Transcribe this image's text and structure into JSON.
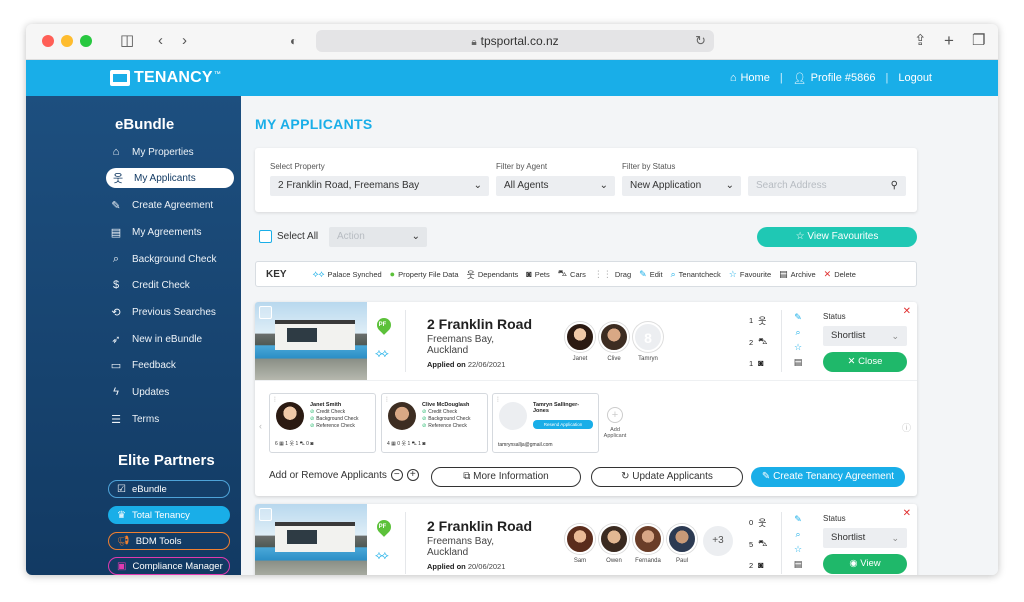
{
  "browser": {
    "url": "tpsportal.co.nz"
  },
  "header": {
    "logo": "TENANCY",
    "logo_tm": "™",
    "home": "Home",
    "profile": "Profile #5866",
    "logout": "Logout"
  },
  "sidebar": {
    "title": "eBundle",
    "items": [
      {
        "label": "My Properties",
        "icon": "home-icon"
      },
      {
        "label": "My Applicants",
        "icon": "users-icon"
      },
      {
        "label": "Create Agreement",
        "icon": "edit-icon"
      },
      {
        "label": "My Agreements",
        "icon": "document-icon"
      },
      {
        "label": "Background Check",
        "icon": "search-doc-icon"
      },
      {
        "label": "Credit Check",
        "icon": "dollar-doc-icon"
      },
      {
        "label": "Previous Searches",
        "icon": "history-icon"
      },
      {
        "label": "New in eBundle",
        "icon": "rocket-icon"
      },
      {
        "label": "Feedback",
        "icon": "chat-icon"
      },
      {
        "label": "Updates",
        "icon": "bolt-icon"
      },
      {
        "label": "Terms",
        "icon": "list-icon"
      }
    ],
    "partners_title": "Elite Partners",
    "partners": [
      {
        "label": "eBundle"
      },
      {
        "label": "Total Tenancy"
      },
      {
        "label": "BDM Tools"
      },
      {
        "label": "Compliance Manager"
      }
    ]
  },
  "main": {
    "title": "MY APPLICANTS",
    "filters": {
      "property_label": "Select Property",
      "property_value": "2 Franklin Road, Freemans Bay",
      "agent_label": "Filter by Agent",
      "agent_value": "All Agents",
      "status_label": "Filter by Status",
      "status_value": "New Application",
      "search_placeholder": "Search Address"
    },
    "select_all": "Select All",
    "action_placeholder": "Action",
    "view_favourites": "View Favourites",
    "key": {
      "title": "KEY",
      "items": [
        "Palace Synched",
        "Property File Data",
        "Dependants",
        "Pets",
        "Cars",
        "Drag",
        "Edit",
        "Tenantcheck",
        "Favourite",
        "Archive",
        "Delete"
      ]
    }
  },
  "cards": [
    {
      "address": "2 Franklin Road",
      "suburb": "Freemans Bay,",
      "city": "Auckland",
      "applied_label": "Applied on",
      "applied_date": "22/06/2021",
      "applicants": [
        "Janet",
        "Clive",
        "Tamryn"
      ],
      "dependants": "1",
      "cars": "2",
      "pets": "1",
      "status_label": "Status",
      "status_value": "Shortlist",
      "action_button": "Close",
      "expanded": {
        "applicants": [
          {
            "name": "Janet Smith",
            "checks": [
              "Credit Check",
              "Background Check",
              "Reference Check"
            ],
            "footer": "6 ▦   1 웃   1 ⛍   0 ◙"
          },
          {
            "name": "Clive McDouglash",
            "checks": [
              "Credit Check",
              "Background Check",
              "Reference Check"
            ],
            "footer": "4 ▦   0 웃   1 ⛍   1 ◙"
          },
          {
            "name": "Tamryn Sallinger-Jones",
            "resend": "Resend Application",
            "email": "tamrynsallja@gmail.com"
          }
        ],
        "add_applicant": "Add Applicant",
        "add_remove": "Add or Remove Applicants",
        "more_info": "More Information",
        "update_applicants": "Update Applicants",
        "create_agreement": "Create Tenancy Agreement"
      }
    },
    {
      "address": "2 Franklin Road",
      "suburb": "Freemans Bay,",
      "city": "Auckland",
      "applied_label": "Applied on",
      "applied_date": "20/06/2021",
      "applicants": [
        "Sam",
        "Owen",
        "Fernanda",
        "Paul"
      ],
      "more_count": "+3",
      "dependants": "0",
      "cars": "5",
      "pets": "2",
      "status_label": "Status",
      "status_value": "Shortlist",
      "action_button": "View"
    }
  ],
  "colors": {
    "accent": "#19aee8",
    "sidebar": "#123a63",
    "green": "#1fb86a",
    "teal": "#1fc8b4",
    "delete": "#e03030"
  }
}
